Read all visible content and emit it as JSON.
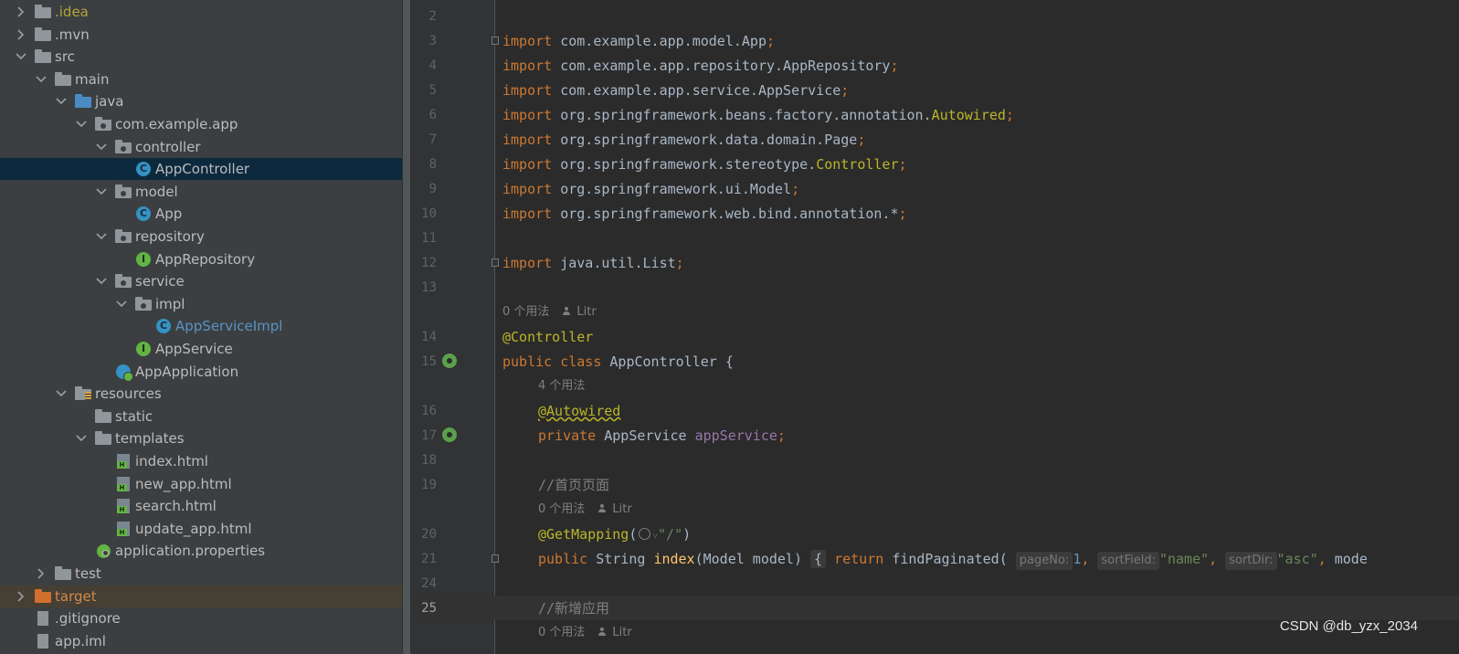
{
  "tree": {
    "items": [
      {
        "label": ".idea",
        "expanded": false,
        "icon": "folder-icon"
      },
      {
        "label": ".mvn",
        "expanded": false,
        "icon": "folder-icon"
      },
      {
        "label": "src",
        "expanded": true,
        "icon": "folder-icon"
      },
      {
        "label": "main",
        "expanded": true,
        "icon": "folder-icon"
      },
      {
        "label": "java",
        "expanded": true,
        "icon": "source-folder-icon"
      },
      {
        "label": "com.example.app",
        "expanded": true,
        "icon": "package-icon"
      },
      {
        "label": "controller",
        "expanded": true,
        "icon": "package-icon"
      },
      {
        "label": "AppController",
        "selected": true,
        "icon": "class-icon"
      },
      {
        "label": "model",
        "expanded": true,
        "icon": "package-icon"
      },
      {
        "label": "App",
        "icon": "class-icon"
      },
      {
        "label": "repository",
        "expanded": true,
        "icon": "package-icon"
      },
      {
        "label": "AppRepository",
        "icon": "interface-icon"
      },
      {
        "label": "service",
        "expanded": true,
        "icon": "package-icon"
      },
      {
        "label": "impl",
        "expanded": true,
        "icon": "package-icon"
      },
      {
        "label": "AppServiceImpl",
        "icon": "class-icon"
      },
      {
        "label": "AppService",
        "icon": "interface-icon"
      },
      {
        "label": "AppApplication",
        "icon": "spring-boot-class-icon"
      },
      {
        "label": "resources",
        "expanded": true,
        "icon": "resources-folder-icon"
      },
      {
        "label": "static",
        "icon": "folder-icon"
      },
      {
        "label": "templates",
        "expanded": true,
        "icon": "folder-icon"
      },
      {
        "label": "index.html",
        "icon": "html-file-icon"
      },
      {
        "label": "new_app.html",
        "icon": "html-file-icon"
      },
      {
        "label": "search.html",
        "icon": "html-file-icon"
      },
      {
        "label": "update_app.html",
        "icon": "html-file-icon"
      },
      {
        "label": "application.properties",
        "icon": "properties-file-icon"
      },
      {
        "label": "test",
        "expanded": false,
        "icon": "folder-icon"
      },
      {
        "label": "target",
        "expanded": false,
        "icon": "excluded-folder-icon"
      },
      {
        "label": ".gitignore",
        "icon": "file-icon"
      },
      {
        "label": "app.iml",
        "icon": "file-icon"
      }
    ]
  },
  "editor": {
    "lines": [
      {
        "num": "2"
      },
      {
        "num": "3",
        "pkg": "com.example.app.model.App"
      },
      {
        "num": "4",
        "pkg": "com.example.app.repository.AppRepository"
      },
      {
        "num": "5",
        "pkg": "com.example.app.service.AppService"
      },
      {
        "num": "6",
        "pkg": "org.springframework.beans.factory.annotation.",
        "ann": "Autowired"
      },
      {
        "num": "7",
        "pkg": "org.springframework.data.domain.Page"
      },
      {
        "num": "8",
        "pkg": "org.springframework.stereotype.",
        "ann": "Controller"
      },
      {
        "num": "9",
        "pkg": "org.springframework.ui.Model"
      },
      {
        "num": "10",
        "pkg": "org.springframework.web.bind.annotation.*"
      },
      {
        "num": "11"
      },
      {
        "num": "12",
        "pkg": "java.util.List"
      },
      {
        "num": "13"
      }
    ],
    "kw_import": "import",
    "semicolon": ";",
    "hint_0_usages": "0 个用法",
    "hint_4_usages": "4 个用法",
    "author": "Litr",
    "line14": {
      "num": "14",
      "ann": "@Controller"
    },
    "line15": {
      "num": "15",
      "kw_public": "public",
      "kw_class": "class",
      "name": "AppController",
      "rest": " {"
    },
    "line16": {
      "num": "16",
      "ann": "@Autowired"
    },
    "line17": {
      "num": "17",
      "kw": "private",
      "type": "AppService",
      "field": "appService"
    },
    "line18": {
      "num": "18"
    },
    "line19": {
      "num": "19",
      "comment": "//首页页面"
    },
    "line20": {
      "num": "20",
      "ann": "@GetMapping",
      "open": "(",
      "str": "\"/\"",
      "close": ")"
    },
    "line21": {
      "num": "21",
      "kw_public": "public",
      "type": "String",
      "method": "index",
      "params": "(Model model)",
      "brace": "{",
      "kw_return": "return",
      "call": "findPaginated(",
      "p1": "pageNo:",
      "v1": "1",
      "p2": "sortField:",
      "v2": "\"name\"",
      "p3": "sortDir:",
      "v3": "\"asc\"",
      "tail": "mode"
    },
    "line24": {
      "num": "24"
    },
    "line25": {
      "num": "25",
      "comment": "//新增应用"
    }
  },
  "watermark": "CSDN @db_yzx_2034"
}
